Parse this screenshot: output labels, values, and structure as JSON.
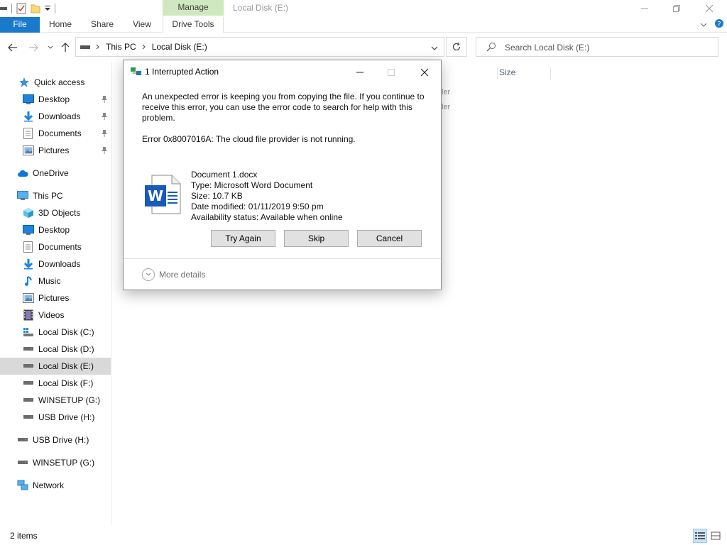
{
  "window": {
    "title": "Local Disk (E:)",
    "contextual_tab": "Manage"
  },
  "ribbon": {
    "tabs": [
      {
        "label": "File"
      },
      {
        "label": "Home"
      },
      {
        "label": "Share"
      },
      {
        "label": "View"
      },
      {
        "label": "Drive Tools"
      }
    ]
  },
  "address": {
    "crumbs": [
      "This PC",
      "Local Disk (E:)"
    ]
  },
  "search": {
    "placeholder": "Search Local Disk (E:)"
  },
  "nav": {
    "items": [
      {
        "label": "Quick access",
        "icon": "star-icon"
      },
      {
        "label": "Desktop",
        "icon": "desktop-icon",
        "pinned": true
      },
      {
        "label": "Downloads",
        "icon": "download-arrow-icon",
        "pinned": true
      },
      {
        "label": "Documents",
        "icon": "documents-icon",
        "pinned": true
      },
      {
        "label": "Pictures",
        "icon": "pictures-icon",
        "pinned": true
      },
      {
        "label": "OneDrive",
        "icon": "cloud-icon"
      },
      {
        "label": "This PC",
        "icon": "computer-icon"
      },
      {
        "label": "3D Objects",
        "icon": "cube-icon"
      },
      {
        "label": "Desktop",
        "icon": "desktop-icon"
      },
      {
        "label": "Documents",
        "icon": "documents-icon"
      },
      {
        "label": "Downloads",
        "icon": "download-arrow-icon"
      },
      {
        "label": "Music",
        "icon": "music-note-icon"
      },
      {
        "label": "Pictures",
        "icon": "pictures-icon"
      },
      {
        "label": "Videos",
        "icon": "film-icon"
      },
      {
        "label": "Local Disk (C:)",
        "icon": "windows-drive-icon"
      },
      {
        "label": "Local Disk (D:)",
        "icon": "drive-icon"
      },
      {
        "label": "Local Disk (E:)",
        "icon": "drive-icon",
        "selected": true
      },
      {
        "label": "Local Disk (F:)",
        "icon": "drive-icon"
      },
      {
        "label": "WINSETUP (G:)",
        "icon": "drive-icon"
      },
      {
        "label": "USB Drive (H:)",
        "icon": "drive-icon"
      },
      {
        "label": "USB Drive (H:)",
        "icon": "drive-icon"
      },
      {
        "label": "WINSETUP (G:)",
        "icon": "drive-icon"
      },
      {
        "label": "Network",
        "icon": "network-icon"
      }
    ]
  },
  "content": {
    "columns": [
      "Size"
    ],
    "ghost_rows": [
      "ler",
      "ler"
    ]
  },
  "status": {
    "item_count": "2 items"
  },
  "dialog": {
    "title": "1 Interrupted Action",
    "message": "An unexpected error is keeping you from copying the file. If you continue to receive this error, you can use the error code to search for help with this problem.",
    "error": "Error 0x8007016A: The cloud file provider is not running.",
    "file": {
      "name": "Document 1.docx",
      "type": "Type: Microsoft Word Document",
      "size": "Size: 10.7 KB",
      "modified": "Date modified: 01/11/2019 9:50 pm",
      "availability": "Availability status: Available when online"
    },
    "buttons": {
      "try_again": "Try Again",
      "skip": "Skip",
      "cancel": "Cancel"
    },
    "more_details": "More details"
  },
  "colors": {
    "file_tab": "#1979ca",
    "manage_tab": "#cfe8bf",
    "selection": "#d9d9d9",
    "word_blue": "#185abd"
  }
}
